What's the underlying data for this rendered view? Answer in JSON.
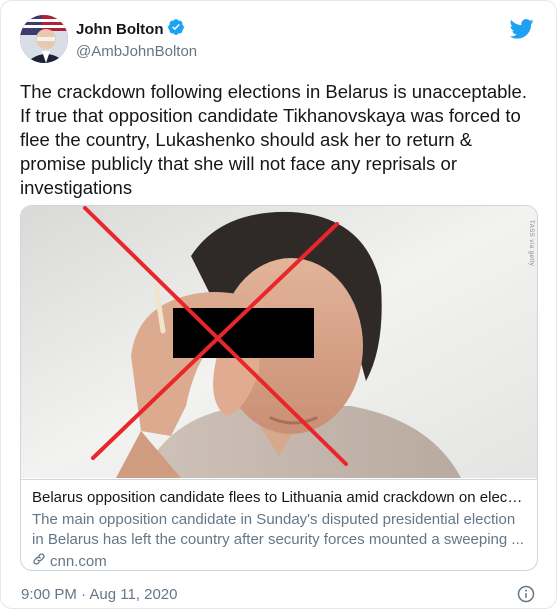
{
  "author": {
    "display_name": "John Bolton",
    "handle": "@AmbJohnBolton"
  },
  "tweet": {
    "text": "The crackdown following elections in Belarus is unacceptable. If true that opposition candidate Tikhanovskaya was forced to flee the country, Lukashenko should ask her to return & promise publicly that she will not face any reprisals or investigations"
  },
  "card": {
    "title": "Belarus opposition candidate flees to Lithuania amid crackdown on electi...",
    "description": "The main opposition candidate in Sunday's disputed presidential election in Belarus has left the country after security forces mounted a sweeping ...",
    "domain": "cnn.com",
    "image_credit": "TASS via getty"
  },
  "timestamp": "9:00 PM · Aug 11, 2020",
  "icons": {
    "verified": "verified-badge-icon",
    "brand": "twitter-bird-icon",
    "link": "link-icon",
    "info": "info-icon"
  },
  "colors": {
    "brand": "#1da1f2",
    "cross": "#e8262b",
    "redaction": "#000000",
    "text_secondary": "#657786"
  }
}
